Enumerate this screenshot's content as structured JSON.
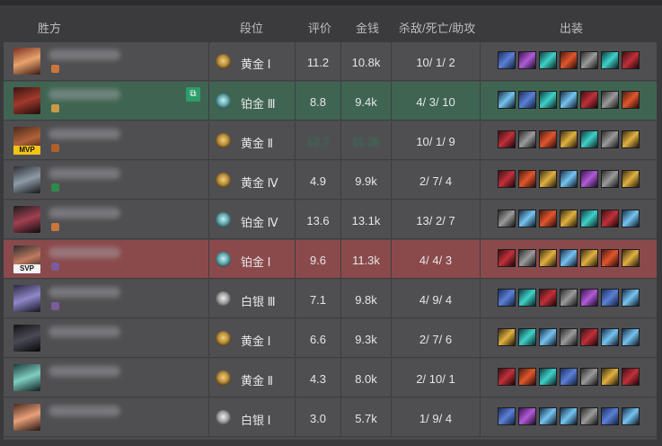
{
  "header": {
    "team": "胜方",
    "rank": "段位",
    "score": "评价",
    "gold": "金钱",
    "kda": "杀敌/死亡/助攻",
    "items": "出装"
  },
  "rows": [
    {
      "rank": "黄金 Ⅰ",
      "score": "11.2",
      "gold": "10.8k",
      "kda": "10/ 1/ 2"
    },
    {
      "rank": "铂金 Ⅲ",
      "score": "8.8",
      "gold": "9.4k",
      "kda": "4/ 3/ 10"
    },
    {
      "rank": "黄金 Ⅱ",
      "score": "12.7",
      "gold": "11.2k",
      "kda": "10/ 1/ 9",
      "badge": "MVP"
    },
    {
      "rank": "黄金 Ⅳ",
      "score": "4.9",
      "gold": "9.9k",
      "kda": "2/ 7/ 4"
    },
    {
      "rank": "铂金 Ⅳ",
      "score": "13.6",
      "gold": "13.1k",
      "kda": "13/ 2/ 7"
    },
    {
      "rank": "铂金 Ⅰ",
      "score": "9.6",
      "gold": "11.3k",
      "kda": "4/ 4/ 3",
      "badge": "SVP"
    },
    {
      "rank": "白银 Ⅲ",
      "score": "7.1",
      "gold": "9.8k",
      "kda": "4/ 9/ 4"
    },
    {
      "rank": "黄金 Ⅰ",
      "score": "6.6",
      "gold": "9.3k",
      "kda": "2/ 7/ 6"
    },
    {
      "rank": "黄金 Ⅱ",
      "score": "4.3",
      "gold": "8.0k",
      "kda": "2/ 10/ 1"
    },
    {
      "rank": "白银 Ⅰ",
      "score": "3.0",
      "gold": "5.7k",
      "kda": "1/ 9/ 4"
    }
  ]
}
